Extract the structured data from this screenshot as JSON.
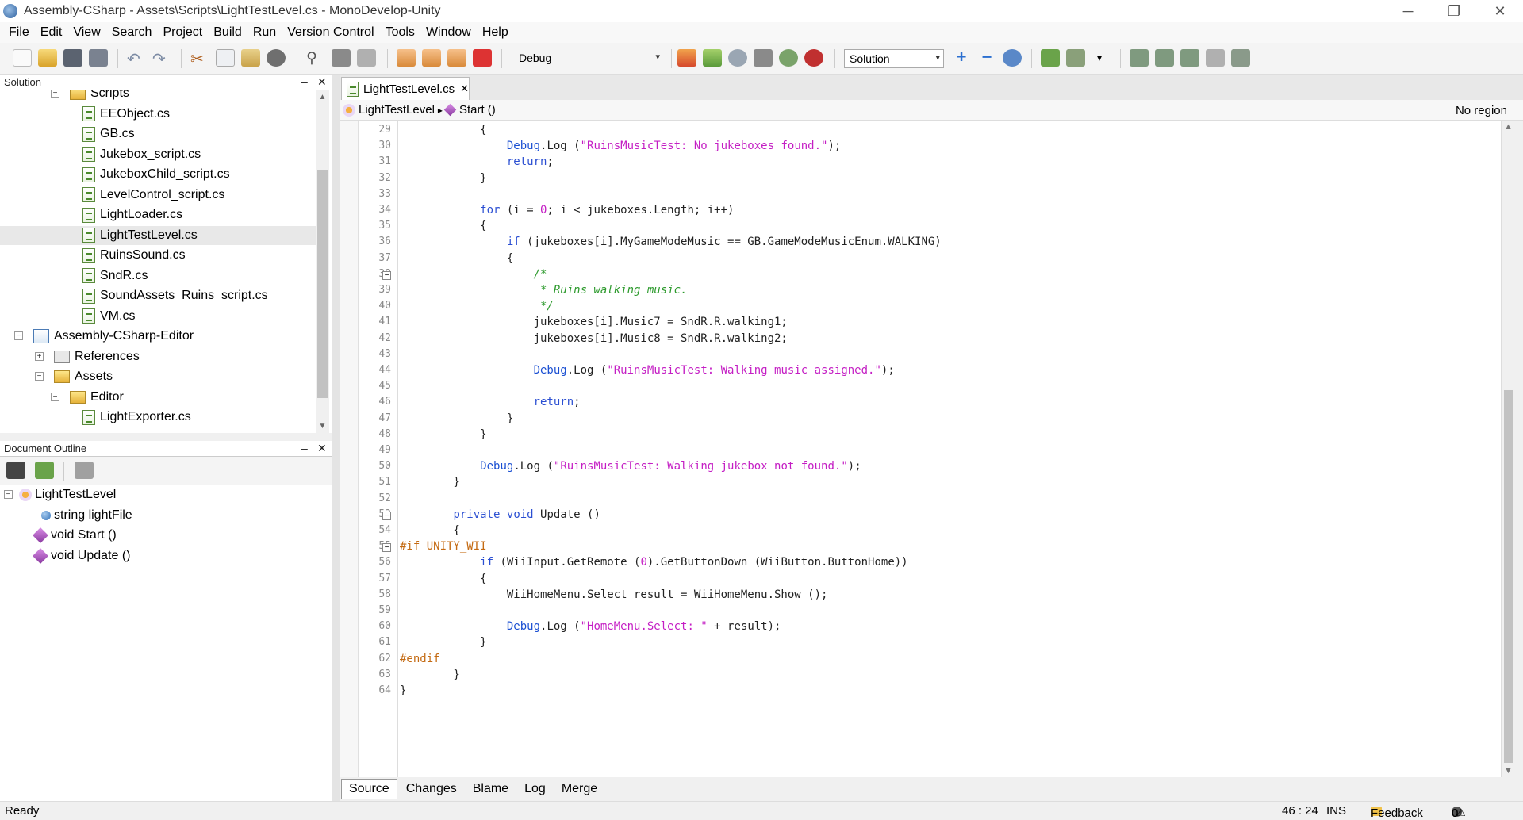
{
  "window": {
    "title": "Assembly-CSharp - Assets\\Scripts\\LightTestLevel.cs - MonoDevelop-Unity",
    "minimize": "─",
    "restore": "❐",
    "close": "✕"
  },
  "menu": [
    "File",
    "Edit",
    "View",
    "Search",
    "Project",
    "Build",
    "Run",
    "Version Control",
    "Tools",
    "Window",
    "Help"
  ],
  "toolbar": {
    "config": "Debug",
    "solution_combo": "Solution",
    "combo_arrow": "▾",
    "icon_colors": {
      "new": "#f7f7f7",
      "open": "#f0c24b",
      "save": "#555c66",
      "undo": "#7b8aa3",
      "cut": "#b06020",
      "paste": "#c9a34a",
      "build": "#d6492c",
      "run": "#5a9a3a",
      "stop": "#c03030",
      "debug": "#3a6fd0"
    }
  },
  "solution_panel": {
    "title": "Solution",
    "minimize": "–",
    "close": "✕",
    "items": [
      {
        "label": "Scripts",
        "type": "folder",
        "expander": "⊟"
      },
      {
        "label": "EEObject.cs",
        "type": "file"
      },
      {
        "label": "GB.cs",
        "type": "file"
      },
      {
        "label": "Jukebox_script.cs",
        "type": "file"
      },
      {
        "label": "JukeboxChild_script.cs",
        "type": "file"
      },
      {
        "label": "LevelControl_script.cs",
        "type": "file"
      },
      {
        "label": "LightLoader.cs",
        "type": "file"
      },
      {
        "label": "LightTestLevel.cs",
        "type": "file",
        "selected": true
      },
      {
        "label": "RuinsSound.cs",
        "type": "file"
      },
      {
        "label": "SndR.cs",
        "type": "file"
      },
      {
        "label": "SoundAssets_Ruins_script.cs",
        "type": "file"
      },
      {
        "label": "VM.cs",
        "type": "file"
      },
      {
        "label": "Assembly-CSharp-Editor",
        "type": "project",
        "expander": "⊟"
      },
      {
        "label": "References",
        "type": "refs",
        "expander": "⊞"
      },
      {
        "label": "Assets",
        "type": "folder",
        "expander": "⊟"
      },
      {
        "label": "Editor",
        "type": "folder",
        "expander": "⊟"
      },
      {
        "label": "LightExporter.cs",
        "type": "file"
      }
    ]
  },
  "outline_panel": {
    "title": "Document Outline",
    "minimize": "–",
    "close": "✕",
    "items": [
      {
        "label": "LightTestLevel",
        "kind": "class",
        "expander": "⊟"
      },
      {
        "label": "string lightFile",
        "kind": "field"
      },
      {
        "label": "void Start ()",
        "kind": "method"
      },
      {
        "label": "void Update ()",
        "kind": "method"
      }
    ]
  },
  "editor": {
    "tab_label": "LightTestLevel.cs",
    "tab_close": "✕",
    "breadcrumb_class": "LightTestLevel",
    "breadcrumb_sep": "▸",
    "breadcrumb_method": "Start ()",
    "region": "No region",
    "line_numbers": [
      "29",
      "30",
      "31",
      "32",
      "33",
      "34",
      "35",
      "36",
      "37",
      "38",
      "39",
      "40",
      "41",
      "42",
      "43",
      "44",
      "45",
      "46",
      "47",
      "48",
      "49",
      "50",
      "51",
      "52",
      "53",
      "54",
      "55",
      "56",
      "57",
      "58",
      "59",
      "60",
      "61",
      "62",
      "63",
      "64"
    ],
    "fold_markers": {
      "38": "−",
      "53": "−",
      "55": "−"
    },
    "lines": [
      [
        [
          "",
          "            {"
        ]
      ],
      [
        [
          "",
          "                "
        ],
        [
          "ident",
          "Debug"
        ],
        [
          "",
          ".Log ("
        ],
        [
          "str",
          "\"RuinsMusicTest: No jukeboxes found.\""
        ],
        [
          "",
          ");"
        ]
      ],
      [
        [
          "",
          "                "
        ],
        [
          "kw",
          "return"
        ],
        [
          "",
          ";"
        ]
      ],
      [
        [
          "",
          "            }"
        ]
      ],
      [
        [
          "",
          ""
        ]
      ],
      [
        [
          "",
          "            "
        ],
        [
          "kw",
          "for"
        ],
        [
          "",
          " (i = "
        ],
        [
          "num",
          "0"
        ],
        [
          "",
          "; i < jukeboxes.Length; i++)"
        ]
      ],
      [
        [
          "",
          "            {"
        ]
      ],
      [
        [
          "",
          "                "
        ],
        [
          "kw",
          "if"
        ],
        [
          "",
          " (jukeboxes[i].MyGameModeMusic == GB.GameModeMusicEnum.WALKING)"
        ]
      ],
      [
        [
          "",
          "                {"
        ]
      ],
      [
        [
          "",
          "                    "
        ],
        [
          "cmt",
          "/*"
        ]
      ],
      [
        [
          "",
          "                    "
        ],
        [
          "cmt",
          " * Ruins walking music."
        ]
      ],
      [
        [
          "",
          "                    "
        ],
        [
          "cmt",
          " */"
        ]
      ],
      [
        [
          "",
          "                    jukeboxes[i].Music7 = SndR.R.walking1;"
        ]
      ],
      [
        [
          "",
          "                    jukeboxes[i].Music8 = SndR.R.walking2;"
        ]
      ],
      [
        [
          "",
          ""
        ]
      ],
      [
        [
          "",
          "                    "
        ],
        [
          "ident",
          "Debug"
        ],
        [
          "",
          ".Log ("
        ],
        [
          "str",
          "\"RuinsMusicTest: Walking music assigned.\""
        ],
        [
          "",
          ");"
        ]
      ],
      [
        [
          "",
          ""
        ]
      ],
      [
        [
          "",
          "                    "
        ],
        [
          "kw",
          "return"
        ],
        [
          "",
          ";"
        ]
      ],
      [
        [
          "",
          "                }"
        ]
      ],
      [
        [
          "",
          "            }"
        ]
      ],
      [
        [
          "",
          ""
        ]
      ],
      [
        [
          "",
          "            "
        ],
        [
          "ident",
          "Debug"
        ],
        [
          "",
          ".Log ("
        ],
        [
          "str",
          "\"RuinsMusicTest: Walking jukebox not found.\""
        ],
        [
          "",
          ");"
        ]
      ],
      [
        [
          "",
          "        }"
        ]
      ],
      [
        [
          "",
          ""
        ]
      ],
      [
        [
          "",
          "        "
        ],
        [
          "kw",
          "private"
        ],
        [
          "",
          " "
        ],
        [
          "kw",
          "void"
        ],
        [
          "",
          " Update ()"
        ]
      ],
      [
        [
          "",
          "        {"
        ]
      ],
      [
        [
          "pp",
          "#if UNITY_WII"
        ]
      ],
      [
        [
          "",
          "            "
        ],
        [
          "kw",
          "if"
        ],
        [
          "",
          " (WiiInput.GetRemote ("
        ],
        [
          "num",
          "0"
        ],
        [
          "",
          ").GetButtonDown (WiiButton.ButtonHome))"
        ]
      ],
      [
        [
          "",
          "            {"
        ]
      ],
      [
        [
          "",
          "                WiiHomeMenu.Select result = WiiHomeMenu.Show ();"
        ]
      ],
      [
        [
          "",
          ""
        ]
      ],
      [
        [
          "",
          "                "
        ],
        [
          "ident",
          "Debug"
        ],
        [
          "",
          ".Log ("
        ],
        [
          "str",
          "\"HomeMenu.Select: \""
        ],
        [
          "",
          " + result);"
        ]
      ],
      [
        [
          "",
          "            }"
        ]
      ],
      [
        [
          "pp",
          "#endif"
        ]
      ],
      [
        [
          "",
          "        }"
        ]
      ],
      [
        [
          "",
          "}"
        ]
      ]
    ]
  },
  "bottom_tabs": [
    "Source",
    "Changes",
    "Blame",
    "Log",
    "Merge"
  ],
  "status": {
    "text": "Ready",
    "position": "46 : 24",
    "mode": "INS",
    "feedback": "Feedback",
    "errors": "0",
    "warnings": "0"
  }
}
